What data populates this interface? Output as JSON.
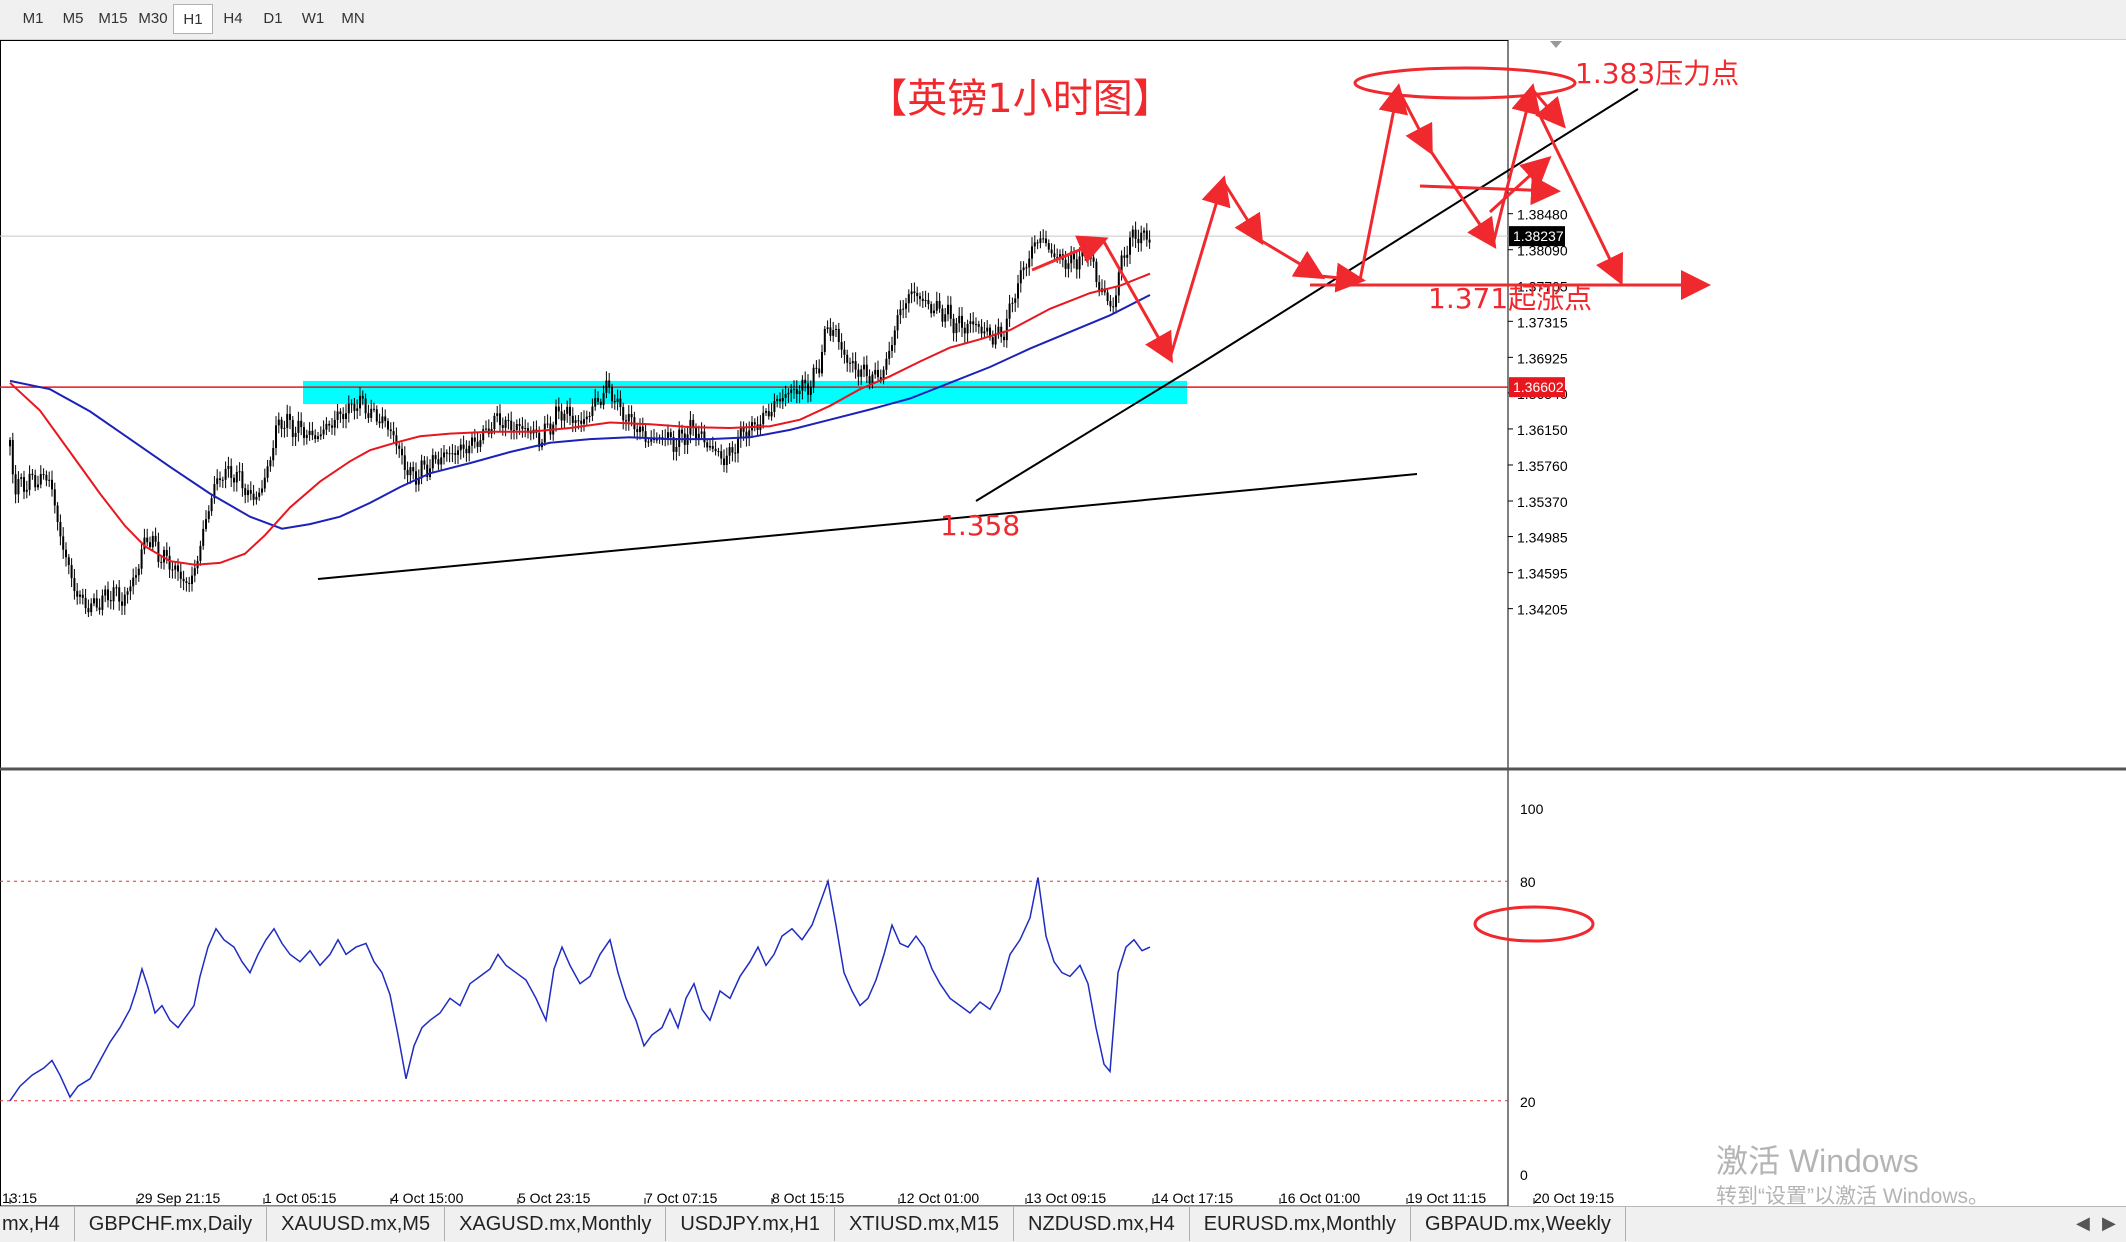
{
  "timeframes": [
    "M1",
    "M5",
    "M15",
    "M30",
    "H1",
    "H4",
    "D1",
    "W1",
    "MN"
  ],
  "active_timeframe": "H1",
  "symbol_tabs": [
    "mx,H4",
    "GBPCHF.mx,Daily",
    "XAUUSD.mx,M5",
    "XAGUSD.mx,Monthly",
    "USDJPY.mx,H1",
    "XTIUSD.mx,M15",
    "NZDUSD.mx,H4",
    "EURUSD.mx,Monthly",
    "GBPAUD.mx,Weekly"
  ],
  "watermark": {
    "line1": "激活 Windows",
    "line2": "转到“设置”以激活 Windows。"
  },
  "colors": {
    "candle": "#000000",
    "ma_fast": "#e8161f",
    "ma_slow": "#1b22b9",
    "support_line": "#e8161f",
    "zone": "#00ffff",
    "annotation": "#f0292f",
    "rsi": "#1f2cc2",
    "level_line": "#e53030"
  },
  "chart_data": [
    {
      "type": "candlestick",
      "title": "【英镑1小时图】",
      "ylim": [
        1.4036,
        1.3248
      ],
      "price_ticks": [
        1.3848,
        1.3809,
        1.37705,
        1.37315,
        1.36925,
        1.3654,
        1.3615,
        1.3576,
        1.3537,
        1.34985,
        1.34595,
        1.34205
      ],
      "price_tick_labels": [
        "1.38480",
        "1.38090",
        "1.37705",
        "1.37315",
        "1.36925",
        "1.36540",
        "1.36150",
        "1.35760",
        "1.35370",
        "1.34985",
        "1.34595",
        "1.34205"
      ],
      "time_labels": [
        "13:15",
        "29 Sep 21:15",
        "1 Oct 05:15",
        "4 Oct 15:00",
        "5 Oct 23:15",
        "7 Oct 07:15",
        "8 Oct 15:15",
        "12 Oct 01:00",
        "13 Oct 09:15",
        "14 Oct 17:15",
        "16 Oct 01:00",
        "19 Oct 11:15",
        "20 Oct 19:15"
      ],
      "current_price": 1.38237,
      "current_price_label": "1.38237",
      "horizontal_level": 1.36602,
      "horizontal_level_label": "1.36602",
      "resistance_zone": [
        1.3667,
        1.3642
      ],
      "close_path": [
        [
          -8,
          1.3667
        ],
        [
          5,
          1.3552
        ],
        [
          20,
          1.3558
        ],
        [
          40,
          1.3563
        ],
        [
          47,
          1.3515
        ],
        [
          60,
          1.3458
        ],
        [
          68,
          1.3433
        ],
        [
          80,
          1.3421
        ],
        [
          95,
          1.3432
        ],
        [
          105,
          1.344
        ],
        [
          112,
          1.3427
        ],
        [
          125,
          1.3455
        ],
        [
          137,
          1.35
        ],
        [
          150,
          1.3478
        ],
        [
          160,
          1.347
        ],
        [
          168,
          1.3458
        ],
        [
          180,
          1.3445
        ],
        [
          192,
          1.3495
        ],
        [
          200,
          1.3538
        ],
        [
          210,
          1.3565
        ],
        [
          220,
          1.3568
        ],
        [
          230,
          1.3561
        ],
        [
          240,
          1.354
        ],
        [
          250,
          1.3545
        ],
        [
          258,
          1.3572
        ],
        [
          265,
          1.361
        ],
        [
          272,
          1.3625
        ],
        [
          282,
          1.3617
        ],
        [
          295,
          1.3612
        ],
        [
          305,
          1.3605
        ],
        [
          318,
          1.3618
        ],
        [
          330,
          1.363
        ],
        [
          340,
          1.3637
        ],
        [
          350,
          1.3645
        ],
        [
          360,
          1.3632
        ],
        [
          372,
          1.3625
        ],
        [
          383,
          1.361
        ],
        [
          392,
          1.3582
        ],
        [
          402,
          1.3562
        ],
        [
          412,
          1.357
        ],
        [
          422,
          1.3577
        ],
        [
          432,
          1.3586
        ],
        [
          445,
          1.359
        ],
        [
          460,
          1.3597
        ],
        [
          472,
          1.3606
        ],
        [
          480,
          1.3618
        ],
        [
          488,
          1.3627
        ],
        [
          496,
          1.3619
        ],
        [
          508,
          1.3617
        ],
        [
          520,
          1.3614
        ],
        [
          530,
          1.3602
        ],
        [
          540,
          1.362
        ],
        [
          552,
          1.3635
        ],
        [
          562,
          1.3627
        ],
        [
          572,
          1.362
        ],
        [
          582,
          1.3638
        ],
        [
          592,
          1.365
        ],
        [
          598,
          1.3663
        ],
        [
          605,
          1.3645
        ],
        [
          615,
          1.3628
        ],
        [
          625,
          1.362
        ],
        [
          635,
          1.3605
        ],
        [
          645,
          1.3602
        ],
        [
          655,
          1.3608
        ],
        [
          665,
          1.3598
        ],
        [
          675,
          1.361
        ],
        [
          685,
          1.3616
        ],
        [
          695,
          1.36
        ],
        [
          705,
          1.3592
        ],
        [
          713,
          1.3581
        ],
        [
          722,
          1.359
        ],
        [
          732,
          1.3612
        ],
        [
          742,
          1.3615
        ],
        [
          752,
          1.3625
        ],
        [
          762,
          1.3638
        ],
        [
          772,
          1.365
        ],
        [
          782,
          1.3656
        ],
        [
          792,
          1.366
        ],
        [
          802,
          1.3664
        ],
        [
          810,
          1.369
        ],
        [
          818,
          1.3727
        ],
        [
          826,
          1.3718
        ],
        [
          836,
          1.369
        ],
        [
          846,
          1.368
        ],
        [
          856,
          1.3675
        ],
        [
          866,
          1.367
        ],
        [
          876,
          1.3682
        ],
        [
          884,
          1.3722
        ],
        [
          894,
          1.3752
        ],
        [
          904,
          1.3764
        ],
        [
          914,
          1.3752
        ],
        [
          924,
          1.3745
        ],
        [
          934,
          1.3742
        ],
        [
          944,
          1.373
        ],
        [
          954,
          1.3725
        ],
        [
          964,
          1.373
        ],
        [
          974,
          1.372
        ],
        [
          984,
          1.3714
        ],
        [
          994,
          1.372
        ],
        [
          1004,
          1.376
        ],
        [
          1014,
          1.379
        ],
        [
          1022,
          1.3808
        ],
        [
          1030,
          1.3825
        ],
        [
          1038,
          1.381
        ],
        [
          1048,
          1.38
        ],
        [
          1058,
          1.3795
        ],
        [
          1068,
          1.38
        ],
        [
          1078,
          1.381
        ],
        [
          1088,
          1.377
        ],
        [
          1096,
          1.376
        ],
        [
          1102,
          1.374
        ],
        [
          1110,
          1.379
        ],
        [
          1118,
          1.3815
        ],
        [
          1126,
          1.3826
        ],
        [
          1134,
          1.3822
        ],
        [
          1142,
          1.3824
        ]
      ],
      "ma_fast": [
        [
          0,
          1.3665
        ],
        [
          30,
          1.3635
        ],
        [
          60,
          1.359
        ],
        [
          90,
          1.3545
        ],
        [
          115,
          1.351
        ],
        [
          135,
          1.3488
        ],
        [
          160,
          1.3472
        ],
        [
          185,
          1.3468
        ],
        [
          210,
          1.347
        ],
        [
          235,
          1.348
        ],
        [
          255,
          1.35
        ],
        [
          280,
          1.353
        ],
        [
          310,
          1.3558
        ],
        [
          340,
          1.358
        ],
        [
          360,
          1.3592
        ],
        [
          385,
          1.36
        ],
        [
          410,
          1.3607
        ],
        [
          440,
          1.361
        ],
        [
          480,
          1.3612
        ],
        [
          520,
          1.3612
        ],
        [
          560,
          1.3616
        ],
        [
          600,
          1.3622
        ],
        [
          640,
          1.362
        ],
        [
          680,
          1.3617
        ],
        [
          720,
          1.3616
        ],
        [
          760,
          1.3618
        ],
        [
          790,
          1.3625
        ],
        [
          820,
          1.364
        ],
        [
          850,
          1.3658
        ],
        [
          880,
          1.3672
        ],
        [
          910,
          1.3688
        ],
        [
          940,
          1.3703
        ],
        [
          970,
          1.3712
        ],
        [
          1000,
          1.3722
        ],
        [
          1040,
          1.3745
        ],
        [
          1080,
          1.3762
        ],
        [
          1110,
          1.377
        ],
        [
          1140,
          1.3783
        ]
      ],
      "ma_slow": [
        [
          0,
          1.3667
        ],
        [
          40,
          1.3658
        ],
        [
          80,
          1.3634
        ],
        [
          120,
          1.3604
        ],
        [
          160,
          1.3574
        ],
        [
          200,
          1.3545
        ],
        [
          240,
          1.352
        ],
        [
          272,
          1.3507
        ],
        [
          300,
          1.3512
        ],
        [
          330,
          1.352
        ],
        [
          360,
          1.3535
        ],
        [
          390,
          1.3552
        ],
        [
          420,
          1.3567
        ],
        [
          460,
          1.3578
        ],
        [
          500,
          1.359
        ],
        [
          540,
          1.36
        ],
        [
          580,
          1.3604
        ],
        [
          620,
          1.3606
        ],
        [
          660,
          1.3604
        ],
        [
          700,
          1.3604
        ],
        [
          740,
          1.3606
        ],
        [
          780,
          1.3614
        ],
        [
          820,
          1.3625
        ],
        [
          860,
          1.3636
        ],
        [
          900,
          1.3648
        ],
        [
          940,
          1.3665
        ],
        [
          980,
          1.3682
        ],
        [
          1020,
          1.3702
        ],
        [
          1060,
          1.372
        ],
        [
          1100,
          1.3738
        ],
        [
          1140,
          1.376
        ]
      ],
      "annotations": [
        {
          "text": "1.383压力点",
          "price": 1.3826
        },
        {
          "text": "1.371起涨点",
          "price": 1.3708
        },
        {
          "text": "1.358",
          "price": 1.3578
        }
      ]
    },
    {
      "type": "line",
      "name": "RSI",
      "ylim": [
        0,
        100
      ],
      "levels": [
        80,
        20
      ],
      "tick_labels": [
        "100",
        "80",
        "20",
        "0"
      ],
      "ticks": [
        100,
        80,
        20,
        0
      ],
      "values": [
        [
          0,
          20
        ],
        [
          10,
          24
        ],
        [
          22,
          27
        ],
        [
          34,
          29
        ],
        [
          42,
          31
        ],
        [
          50,
          27
        ],
        [
          60,
          21
        ],
        [
          68,
          24
        ],
        [
          80,
          26
        ],
        [
          90,
          31
        ],
        [
          100,
          36
        ],
        [
          110,
          40
        ],
        [
          120,
          45
        ],
        [
          126,
          50
        ],
        [
          132,
          56
        ],
        [
          138,
          51
        ],
        [
          145,
          44
        ],
        [
          152,
          46
        ],
        [
          160,
          42
        ],
        [
          168,
          40
        ],
        [
          176,
          43
        ],
        [
          184,
          46
        ],
        [
          190,
          54
        ],
        [
          198,
          62
        ],
        [
          206,
          67
        ],
        [
          214,
          64
        ],
        [
          224,
          62
        ],
        [
          232,
          58
        ],
        [
          240,
          55
        ],
        [
          248,
          60
        ],
        [
          256,
          64
        ],
        [
          264,
          67
        ],
        [
          272,
          63
        ],
        [
          280,
          60
        ],
        [
          290,
          58
        ],
        [
          300,
          61
        ],
        [
          310,
          57
        ],
        [
          320,
          60
        ],
        [
          328,
          64
        ],
        [
          336,
          60
        ],
        [
          346,
          62
        ],
        [
          356,
          63
        ],
        [
          364,
          58
        ],
        [
          372,
          55
        ],
        [
          380,
          49
        ],
        [
          388,
          38
        ],
        [
          396,
          26
        ],
        [
          404,
          35
        ],
        [
          412,
          40
        ],
        [
          420,
          42
        ],
        [
          430,
          44
        ],
        [
          440,
          48
        ],
        [
          450,
          46
        ],
        [
          460,
          52
        ],
        [
          470,
          54
        ],
        [
          480,
          56
        ],
        [
          488,
          60
        ],
        [
          496,
          57
        ],
        [
          506,
          55
        ],
        [
          516,
          53
        ],
        [
          526,
          48
        ],
        [
          536,
          42
        ],
        [
          544,
          56
        ],
        [
          552,
          62
        ],
        [
          560,
          57
        ],
        [
          570,
          52
        ],
        [
          580,
          54
        ],
        [
          590,
          60
        ],
        [
          600,
          64
        ],
        [
          608,
          55
        ],
        [
          616,
          48
        ],
        [
          626,
          42
        ],
        [
          634,
          35
        ],
        [
          642,
          38
        ],
        [
          652,
          40
        ],
        [
          660,
          45
        ],
        [
          668,
          40
        ],
        [
          676,
          48
        ],
        [
          684,
          52
        ],
        [
          692,
          45
        ],
        [
          700,
          42
        ],
        [
          710,
          50
        ],
        [
          720,
          48
        ],
        [
          730,
          54
        ],
        [
          740,
          58
        ],
        [
          748,
          62
        ],
        [
          756,
          57
        ],
        [
          764,
          60
        ],
        [
          772,
          65
        ],
        [
          782,
          67
        ],
        [
          792,
          64
        ],
        [
          802,
          68
        ],
        [
          810,
          74
        ],
        [
          818,
          80
        ],
        [
          826,
          68
        ],
        [
          834,
          55
        ],
        [
          842,
          50
        ],
        [
          850,
          46
        ],
        [
          858,
          48
        ],
        [
          866,
          53
        ],
        [
          874,
          60
        ],
        [
          882,
          68
        ],
        [
          890,
          63
        ],
        [
          898,
          62
        ],
        [
          906,
          65
        ],
        [
          914,
          62
        ],
        [
          922,
          56
        ],
        [
          930,
          52
        ],
        [
          940,
          48
        ],
        [
          950,
          46
        ],
        [
          960,
          44
        ],
        [
          970,
          47
        ],
        [
          980,
          45
        ],
        [
          990,
          50
        ],
        [
          1000,
          60
        ],
        [
          1010,
          64
        ],
        [
          1020,
          70
        ],
        [
          1028,
          81
        ],
        [
          1036,
          65
        ],
        [
          1044,
          58
        ],
        [
          1052,
          55
        ],
        [
          1060,
          54
        ],
        [
          1070,
          57
        ],
        [
          1078,
          52
        ],
        [
          1086,
          40
        ],
        [
          1094,
          30
        ],
        [
          1100,
          28
        ],
        [
          1108,
          55
        ],
        [
          1116,
          62
        ],
        [
          1124,
          64
        ],
        [
          1132,
          61
        ],
        [
          1140,
          62
        ]
      ]
    }
  ]
}
